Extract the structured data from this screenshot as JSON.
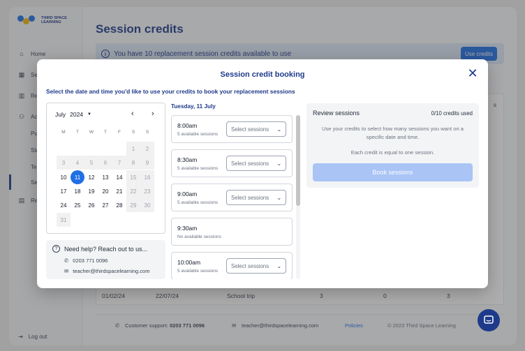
{
  "logo": {
    "text_line1": "THIRD SPACE",
    "text_line2": "LEARNING"
  },
  "sidebar": {
    "items": [
      {
        "label": "Home",
        "icon": "home-icon"
      },
      {
        "label": "Se",
        "icon": "calendar-icon"
      },
      {
        "label": "Re",
        "icon": "chart-icon"
      },
      {
        "label": "Ac",
        "icon": "users-icon"
      },
      {
        "label": "Pu",
        "icon": ""
      },
      {
        "label": "Sta",
        "icon": ""
      },
      {
        "label": "Te",
        "icon": ""
      },
      {
        "label": "Se",
        "icon": ""
      },
      {
        "label": "Re",
        "icon": "report-icon"
      }
    ],
    "logout": "Log out"
  },
  "page": {
    "title": "Session credits",
    "banner_text": "You have 10 replacement session credits available to use",
    "use_credits_label": "Use credits",
    "partial_header": "s",
    "last_row": {
      "col1": "01/02/24",
      "col2": "22/07/24",
      "col3": "School trip",
      "col4": "3",
      "col5": "0",
      "col6": "3"
    }
  },
  "footer": {
    "support_label": "Customer support:",
    "support_phone": "0203 771 0096",
    "email": "teacher@thirdspacelearning.com",
    "policies": "Policies",
    "copyright": "© 2023 Third Space Learning"
  },
  "modal": {
    "title": "Session credit booking",
    "subtitle": "Select the date and time you'd like to use your credits to book your replacement sessions",
    "calendar": {
      "month": "July",
      "year": "2024",
      "weekdays": [
        "M",
        "T",
        "W",
        "T",
        "F",
        "S",
        "S"
      ],
      "weeks": [
        [
          "",
          "",
          "",
          "",
          "1",
          "2"
        ],
        [
          "3",
          "4",
          "5",
          "6",
          "7",
          "8",
          "9"
        ],
        [
          "10",
          "11",
          "12",
          "13",
          "14",
          "15",
          "16"
        ],
        [
          "17",
          "18",
          "19",
          "20",
          "21",
          "22",
          "23"
        ],
        [
          "24",
          "25",
          "26",
          "27",
          "28",
          "29",
          "30"
        ],
        [
          "31"
        ]
      ],
      "selected": "11"
    },
    "help": {
      "title": "Need help? Reach out to us...",
      "phone": "0203 771 0096",
      "email": "teacher@thirdspacelearning.com"
    },
    "slots_date": "Tuesday, 11 July",
    "slots": [
      {
        "time": "8:00am",
        "availability": "5 available sessions",
        "select": "Select sessions"
      },
      {
        "time": "8:30am",
        "availability": "5 available sessions",
        "select": "Select sessions"
      },
      {
        "time": "9:00am",
        "availability": "5 available sessions",
        "select": "Select sessions"
      },
      {
        "time": "9:30am",
        "availability": "No available sessions",
        "select": ""
      },
      {
        "time": "10:00am",
        "availability": "5 available sessions",
        "select": "Select sessions"
      }
    ],
    "review": {
      "title": "Review sessions",
      "credits_used": "0/10 credits used",
      "text1": "Use your credits to select how many sessions you want on a specific date and time.",
      "text2": "Each credit is equal to one session.",
      "book_label": "Book sessions"
    }
  },
  "colors": {
    "brand": "#1e3a8a",
    "accent": "#1f6fe5",
    "disabled_button": "#a9c4f5"
  }
}
